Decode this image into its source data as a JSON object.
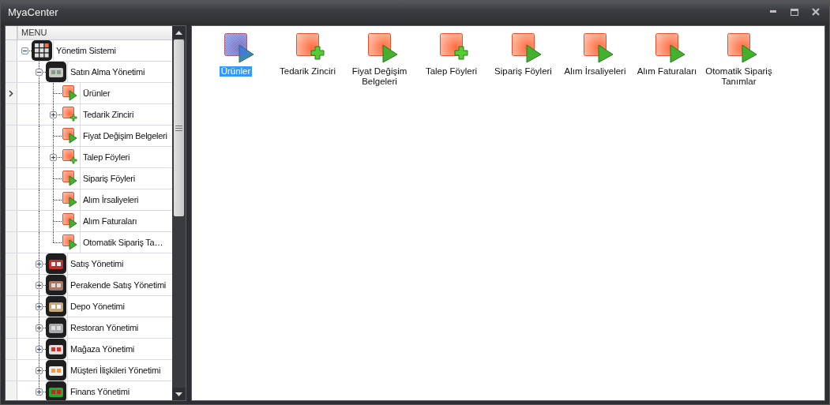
{
  "window": {
    "title": "MyaCenter"
  },
  "menu": {
    "header": "MENU",
    "items": [
      {
        "label": "Yönetim Sistemi",
        "kind": "module",
        "expanded": true,
        "selected": false,
        "children": [
          {
            "label": "Satın Alma Yönetimi",
            "kind": "module",
            "expanded": true,
            "selected": false,
            "children": [
              {
                "label": "Ürünler",
                "kind": "run",
                "selected": true
              },
              {
                "label": "Tedarik Zinciri",
                "kind": "add",
                "expanded": false,
                "selected": false
              },
              {
                "label": "Fiyat Değişim Belgeleri",
                "kind": "run",
                "selected": false
              },
              {
                "label": "Talep Föyleri",
                "kind": "add",
                "expanded": false,
                "selected": false
              },
              {
                "label": "Sipariş Föyleri",
                "kind": "run",
                "selected": false
              },
              {
                "label": "Alım İrsaliyeleri",
                "kind": "run",
                "selected": false
              },
              {
                "label": "Alım Faturaları",
                "kind": "run",
                "selected": false
              },
              {
                "label": "Otomatik Sipariş Ta…",
                "kind": "run",
                "selected": false
              }
            ]
          },
          {
            "label": "Satış Yönetimi",
            "kind": "module",
            "expanded": false,
            "selected": false
          },
          {
            "label": "Perakende Satış Yönetimi",
            "kind": "module",
            "expanded": false,
            "selected": false
          },
          {
            "label": "Depo Yönetimi",
            "kind": "module",
            "expanded": false,
            "selected": false
          },
          {
            "label": "Restoran Yönetimi",
            "kind": "module",
            "expanded": false,
            "selected": false
          },
          {
            "label": "Mağaza Yönetimi",
            "kind": "module",
            "expanded": false,
            "selected": false
          },
          {
            "label": "Müşteri İlişkileri Yönetimi",
            "kind": "module",
            "expanded": false,
            "selected": false
          },
          {
            "label": "Finans Yönetimi",
            "kind": "module",
            "expanded": false,
            "selected": false
          }
        ]
      }
    ]
  },
  "shortcuts": [
    {
      "label": "Ürünler",
      "kind": "run",
      "selected": true
    },
    {
      "label": "Tedarik Zinciri",
      "kind": "add",
      "selected": false
    },
    {
      "label": "Fiyat Değişim Belgeleri",
      "kind": "run",
      "selected": false
    },
    {
      "label": "Talep Föyleri",
      "kind": "add",
      "selected": false
    },
    {
      "label": "Sipariş Föyleri",
      "kind": "run",
      "selected": false
    },
    {
      "label": "Alım İrsaliyeleri",
      "kind": "run",
      "selected": false
    },
    {
      "label": "Alım Faturaları",
      "kind": "run",
      "selected": false
    },
    {
      "label": "Otomatik Sipariş Tanımlar",
      "kind": "run",
      "selected": false
    }
  ]
}
